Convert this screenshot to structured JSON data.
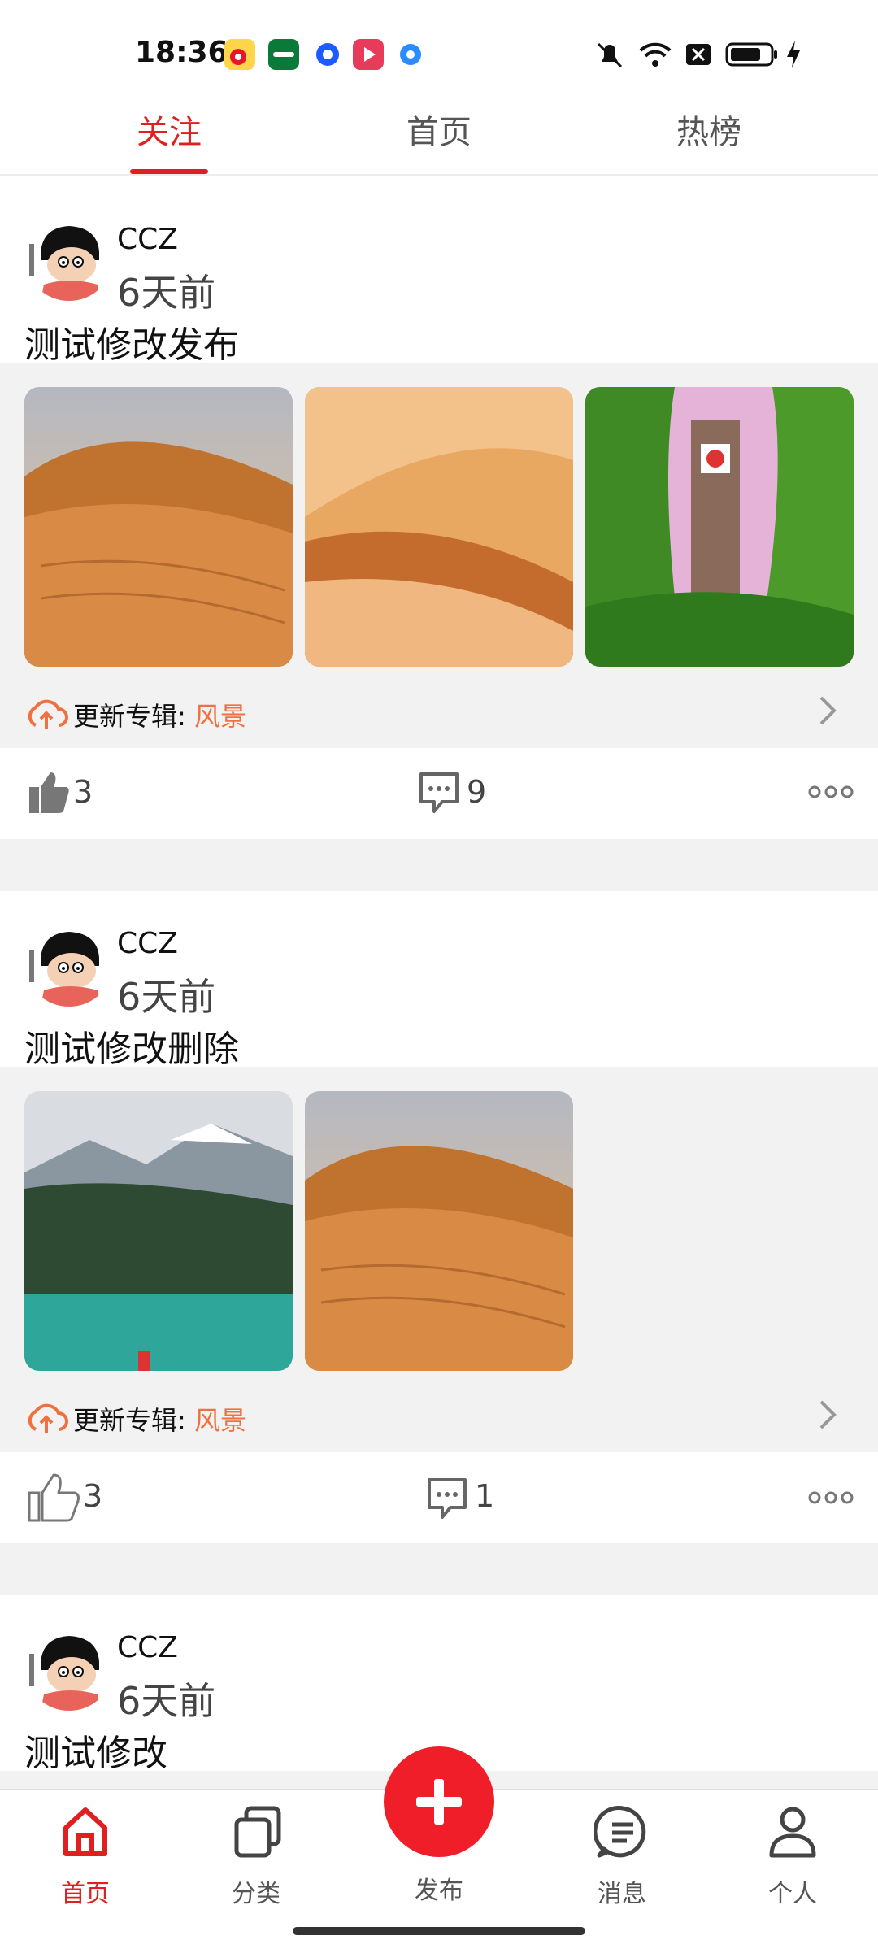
{
  "status_bar": {
    "time": "18:36",
    "app_icons": [
      "weibo-icon",
      "oppo-icon",
      "message-icon",
      "video-icon",
      "browser-icon"
    ],
    "right_icons": [
      "mute-icon",
      "wifi-icon",
      "sim-off-icon",
      "battery-icon",
      "charging-icon"
    ]
  },
  "tabs": [
    {
      "label": "关注",
      "active": true
    },
    {
      "label": "首页",
      "active": false
    },
    {
      "label": "热榜",
      "active": false
    }
  ],
  "posts": [
    {
      "username": "CCZ",
      "time": "6天前",
      "title": "测试修改发布",
      "images": [
        "desert-dune",
        "sand-dunes",
        "clock-tower-trees"
      ],
      "album_prefix": "更新专辑:",
      "album_name": "风景",
      "likes": "3",
      "comments": "9"
    },
    {
      "username": "CCZ",
      "time": "6天前",
      "title": "测试修改删除",
      "images": [
        "mountain-lake",
        "desert-dune"
      ],
      "album_prefix": "更新专辑:",
      "album_name": "风景",
      "likes": "3",
      "comments": "1"
    },
    {
      "username": "CCZ",
      "time": "6天前",
      "title": "测试修改"
    }
  ],
  "bottom_nav": [
    {
      "label": "首页",
      "icon": "home-icon",
      "active": true
    },
    {
      "label": "分类",
      "icon": "category-icon",
      "active": false
    },
    {
      "label": "发布",
      "icon": "plus-icon",
      "active": false
    },
    {
      "label": "消息",
      "icon": "message-icon",
      "active": false
    },
    {
      "label": "个人",
      "icon": "person-icon",
      "active": false
    }
  ],
  "colors": {
    "accent": "#e02020",
    "album_link": "#f07040",
    "band": "#f2f2f2"
  }
}
